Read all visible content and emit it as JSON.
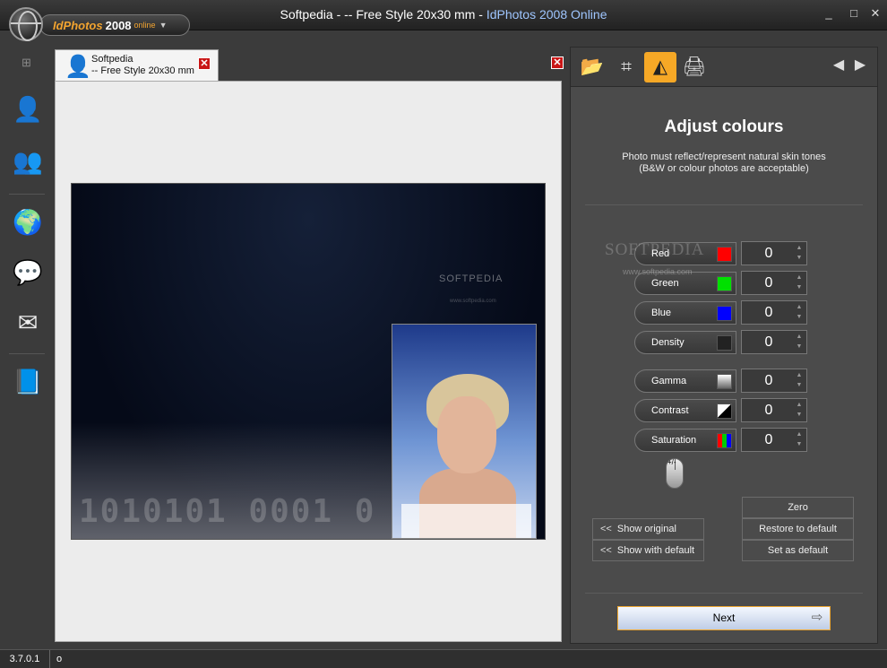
{
  "window": {
    "title_prefix": "Softpedia - -- Free Style 20x30 mm - ",
    "title_app": "IdPhotos 2008 Online",
    "minimize": "_",
    "maximize": "□",
    "close": "✕"
  },
  "logo": {
    "app": "IdPhotos",
    "year": "2008",
    "edition": "online",
    "arrow": "▼"
  },
  "left_toolbar": [
    {
      "name": "person-icon",
      "glyph": "👤"
    },
    {
      "name": "photo-sheet-icon",
      "glyph": "👥"
    },
    {
      "name": "globe-home-icon",
      "glyph": "🌍"
    },
    {
      "name": "chat-bubbles-icon",
      "glyph": "💬"
    },
    {
      "name": "mail-edit-icon",
      "glyph": "✉"
    },
    {
      "name": "book-icon",
      "glyph": "📘"
    }
  ],
  "document_tab": {
    "title": "Softpedia",
    "subtitle": "-- Free Style 20x30 mm",
    "close": "✕"
  },
  "preview": {
    "watermark": "SOFTPEDIA",
    "watermark_url": "www.softpedia.com",
    "binary": "1010101 0001 0"
  },
  "panel": {
    "tools": [
      {
        "name": "open-folder-icon",
        "glyph": "📂",
        "active": false
      },
      {
        "name": "crop-icon",
        "glyph": "⌗",
        "active": false
      },
      {
        "name": "colour-prism-icon",
        "glyph": "◭",
        "active": true
      },
      {
        "name": "printer-icon",
        "glyph": "🖨",
        "active": false
      }
    ],
    "nav_back": "◀",
    "nav_forward": "▶",
    "heading": "Adjust colours",
    "note_line1": "Photo must reflect/represent natural skin tones",
    "note_line2": "(B&W or colour photos are acceptable)",
    "sliders": [
      {
        "label": "Red",
        "value": "0",
        "swatch": "#ff0000"
      },
      {
        "label": "Green",
        "value": "0",
        "swatch": "#00e000"
      },
      {
        "label": "Blue",
        "value": "0",
        "swatch": "#0000ff"
      },
      {
        "label": "Density",
        "value": "0",
        "swatch": "#222222"
      },
      {
        "label": "Gamma",
        "value": "0",
        "swatch": "gradient-grey"
      },
      {
        "label": "Contrast",
        "value": "0",
        "swatch": "contrast"
      },
      {
        "label": "Saturation",
        "value": "0",
        "swatch": "rgb-bars"
      }
    ],
    "mouse_hint": "+/-",
    "buttons": {
      "show_original": "Show original",
      "show_with_default": "Show with default",
      "chevron": "<<",
      "zero": "Zero",
      "restore_default": "Restore to default",
      "set_default": "Set as default",
      "next": "Next",
      "next_arrow": "⇨"
    }
  },
  "overlay_watermark": {
    "text": "SOFTPEDIA",
    "url": "www.softpedia.com"
  },
  "status": {
    "version": "3.7.0.1",
    "message": "o"
  },
  "colors": {
    "accent": "#f6a826",
    "title_accent": "#9fc6ff",
    "panel_bg": "#4b4b4b"
  }
}
